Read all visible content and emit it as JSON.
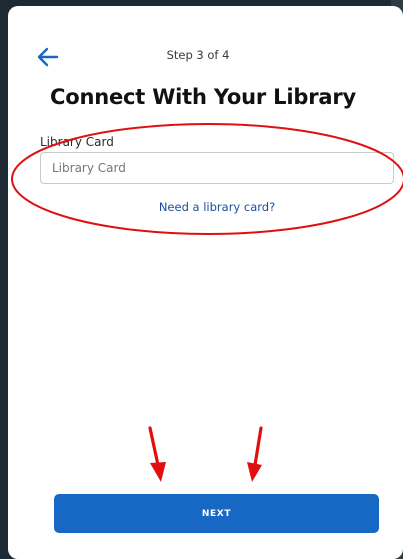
{
  "header": {
    "back_icon": "arrow-left-icon",
    "step_label": "Step 3 of 4"
  },
  "main": {
    "title": "Connect With Your Library",
    "library_card": {
      "label": "Library Card",
      "value": "",
      "placeholder": "Library Card"
    },
    "help_link": "Need a library card?"
  },
  "footer": {
    "next_label": "NEXT"
  },
  "colors": {
    "accent": "#1767c5",
    "link": "#1a4f9c",
    "annotation": "#e01010"
  }
}
